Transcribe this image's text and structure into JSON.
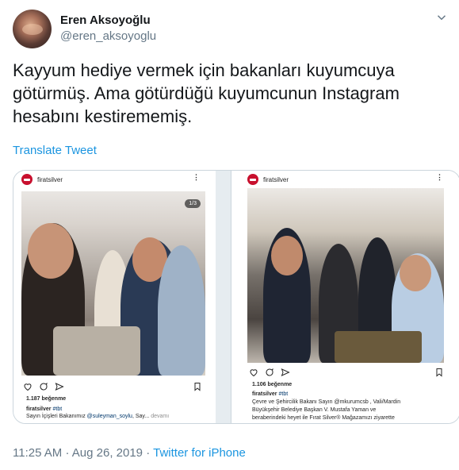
{
  "tweet": {
    "display_name": "Eren Aksoyoğlu",
    "username": "@eren_aksoyoglu",
    "text": "Kayyum hediye vermek için bakanları kuyumcuya götürmüş. Ama götürdüğü kuyumcunun Instagram hesabını kestirememiş.",
    "translate_label": "Translate Tweet",
    "time": "11:25 AM",
    "separator": "·",
    "date": "Aug 26, 2019",
    "source_separator": "·",
    "source": "Twitter for iPhone"
  },
  "media": {
    "left": {
      "account": "firatsilver",
      "counter": "1/3",
      "likes": "1.187 beğenme",
      "caption_account": "firatsilver",
      "caption_tag": "#tbt",
      "caption_prefix": "Sayın İçişleri Bakanımız",
      "caption_mention": "@suleyman_soylu",
      "caption_suffix": ", Say...",
      "caption_more": "devamı"
    },
    "right": {
      "account": "firatsilver",
      "likes": "1.106 beğenme",
      "caption_account": "firatsilver",
      "caption_tag": "#tbt",
      "caption_line1": "Çevre ve Şehircilik Bakanı Sayın @mkurumcsb , Vali/Mardin",
      "caption_line2": "Büyükşehir Belediye Başkan V. Mustafa Yaman ve",
      "caption_line3": "beraberindeki heyet ile Fırat Silver® Mağazamızı ziyarette"
    }
  },
  "colors": {
    "link": "#1b95e0",
    "muted": "#657786",
    "brand_red": "#c8102e"
  },
  "icons": [
    "more-icon",
    "heart-icon",
    "comment-icon",
    "share-icon",
    "bookmark-icon"
  ]
}
